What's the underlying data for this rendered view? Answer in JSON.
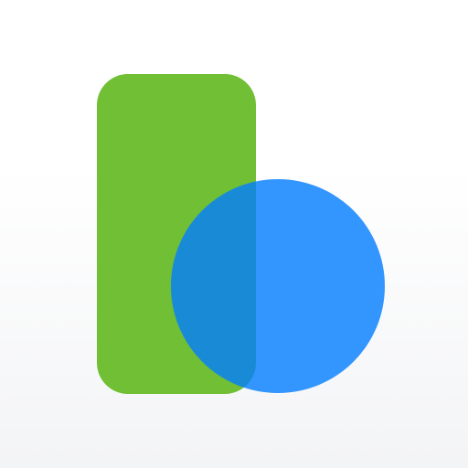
{
  "icon": {
    "name": "app-logo-icon",
    "colors": {
      "bar": "#70bf34",
      "circle": "#3395fe",
      "overlap": "#198bd6",
      "background_top": "#ffffff",
      "background_bottom": "#f3f4f6"
    }
  }
}
